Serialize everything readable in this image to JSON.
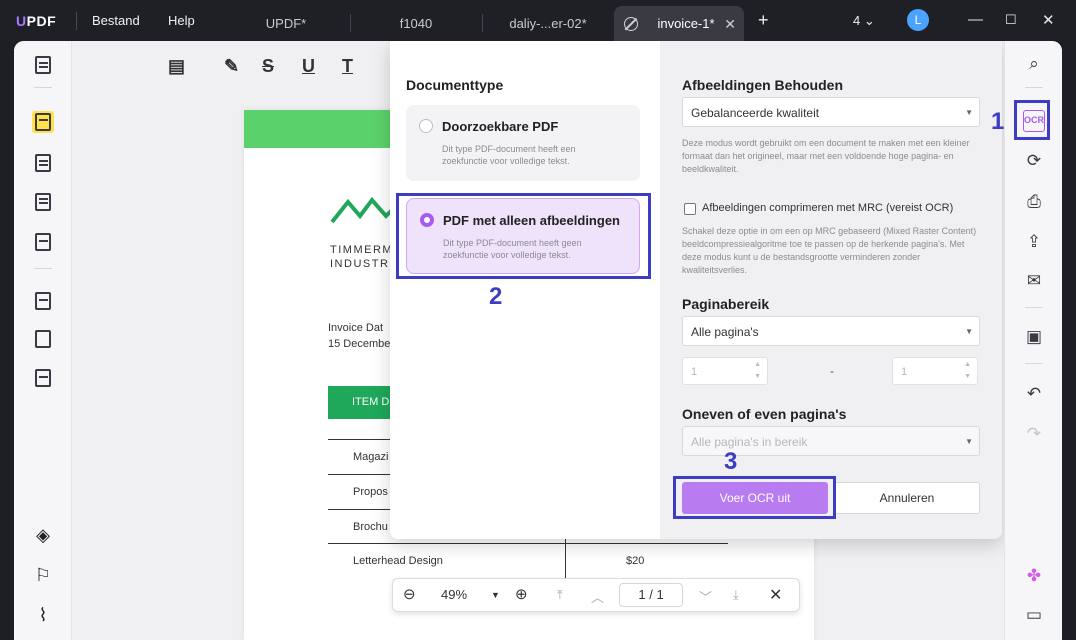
{
  "app": {
    "logo": "UPDF"
  },
  "menu": {
    "file": "Bestand",
    "help": "Help"
  },
  "tabs": [
    {
      "label": "UPDF*"
    },
    {
      "label": "f1040"
    },
    {
      "label": "daliy-...er-02*"
    },
    {
      "label": "invoice-1*",
      "active": true
    }
  ],
  "titlebar": {
    "window_count": "4",
    "avatar_letter": "L",
    "new_tab": "+",
    "close_tab": "✕",
    "minimize": "—",
    "maximize": "☐",
    "close": "✕"
  },
  "document": {
    "company_line1": "TIMMERM",
    "company_line2": "INDUSTRI",
    "invoice_date_label": "Invoice Dat",
    "invoice_date_value": "15 Decembe",
    "table_header": "ITEM D",
    "rows": [
      {
        "item": "Magazi",
        "price": ""
      },
      {
        "item": "Propos",
        "price": ""
      },
      {
        "item": "Brochu",
        "price": ""
      },
      {
        "item": "Letterhead Design",
        "price": "$20"
      }
    ]
  },
  "zoombar": {
    "zoom": "49%",
    "page_current": "1",
    "page_sep": "/",
    "page_total": "1"
  },
  "dialog": {
    "doc_type_title": "Documenttype",
    "options": [
      {
        "title": "Doorzoekbare PDF",
        "desc": "Dit type PDF-document heeft een zoekfunctie voor volledige tekst."
      },
      {
        "title": "PDF met alleen afbeeldingen",
        "desc": "Dit type PDF-document heeft geen zoekfunctie voor volledige tekst."
      }
    ],
    "selected_option": 1,
    "keep_images_title": "Afbeeldingen Behouden",
    "keep_images_value": "Gebalanceerde kwaliteit",
    "keep_images_desc": "Deze modus wordt gebruikt om een document te maken met een kleiner formaat dan het origineel, maar met een voldoende hoge pagina- en beeldkwaliteit.",
    "mrc_label": "Afbeeldingen comprimeren met MRC (vereist OCR)",
    "mrc_checked": false,
    "mrc_desc": "Schakel deze optie in om een op MRC gebaseerd (Mixed Raster Content) beeldcompressiealgoritme toe te passen op de herkende pagina's. Met deze modus kunt u de bestandsgrootte verminderen zonder kwaliteitsverlies.",
    "page_range_title": "Paginabereik",
    "page_range_value": "Alle pagina's",
    "range_from": "1",
    "range_dash": "-",
    "range_to": "1",
    "odd_even_title": "Oneven of even pagina's",
    "odd_even_value": "Alle pagina's in bereik",
    "run_button": "Voer OCR uit",
    "cancel_button": "Annuleren"
  },
  "annotations": {
    "n1": "1",
    "n2": "2",
    "n3": "3",
    "color": "#3c3dc3"
  },
  "colors": {
    "accent": "#a75bf0",
    "doc_header": "#5bd16b",
    "table_header": "#1fa85a"
  },
  "icons": {
    "left_toolbar": [
      "reader-icon",
      "highlight-icon",
      "edit-pdf-icon",
      "form-icon",
      "organize-icon",
      "pages-icon",
      "crop-icon",
      "compress-icon",
      "layers-icon",
      "bookmark-icon",
      "attachment-icon"
    ],
    "right_toolbar": [
      "search-icon",
      "ocr-icon",
      "convert-icon",
      "protect-icon",
      "share-icon",
      "email-icon",
      "save-icon",
      "undo-icon",
      "redo-icon",
      "ai-icon",
      "comment-icon"
    ]
  }
}
